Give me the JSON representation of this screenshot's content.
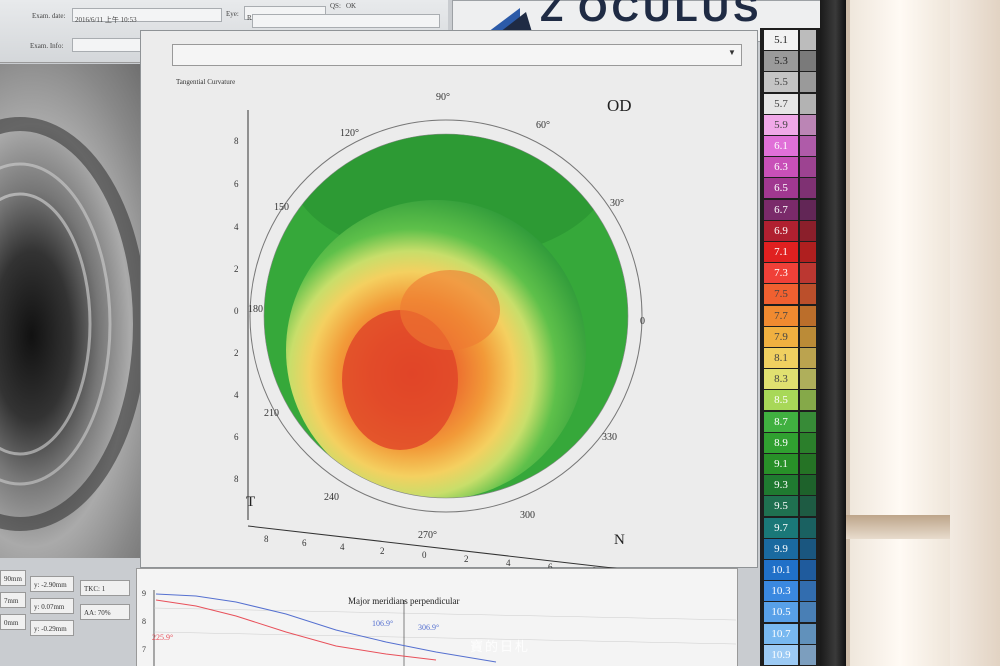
{
  "header": {
    "exam_date_label": "Exam. date:",
    "exam_date_value": "2016/6/11 上午 10:53",
    "eye_label": "Eye:",
    "eye_value": "Right",
    "qs_label": "QS:",
    "qs_value": "OK",
    "exam_info_label": "Exam. Info:"
  },
  "logo": {
    "text": "OCULUS",
    "prefix": "Z"
  },
  "map": {
    "dropdown_value": "Tangential Curvature",
    "eye_side": "OD",
    "temporal_label": "T",
    "nasal_label": "N",
    "angle_labels": [
      "90°",
      "60°",
      "30°",
      "0",
      "330",
      "300",
      "270°",
      "240",
      "210",
      "180",
      "150",
      "120°"
    ],
    "y_ticks": [
      "8",
      "6",
      "4",
      "2",
      "0",
      "2",
      "4",
      "6",
      "8"
    ],
    "x_ticks": [
      "8",
      "6",
      "4",
      "2",
      "0",
      "2",
      "4",
      "6",
      "8"
    ]
  },
  "info": {
    "rows": [
      {
        "a": "90mm",
        "b": "y: -2.90mm",
        "c": "TKC: 1"
      },
      {
        "a": "7mm",
        "b": "y: 0.07mm",
        "c": "AA: 70%"
      },
      {
        "a": "0mm",
        "b": "y: -0.29mm",
        "c": ""
      }
    ]
  },
  "graph": {
    "title": "Major meridians perpendicular",
    "label_left": "225.9°",
    "label_mid1": "106.9°",
    "label_mid2": "306.9°",
    "y_labels": [
      "9",
      "8",
      "7"
    ],
    "colors": {
      "red": "#e8505a",
      "blue": "#5570d0"
    }
  },
  "scale": {
    "values": [
      "5.1",
      "5.3",
      "5.5",
      "5.7",
      "5.9",
      "6.1",
      "6.3",
      "6.5",
      "6.7",
      "6.9",
      "7.1",
      "7.3",
      "7.5",
      "7.7",
      "7.9",
      "8.1",
      "8.3",
      "8.5",
      "8.7",
      "8.9",
      "9.1",
      "9.3",
      "9.5",
      "9.7",
      "9.9",
      "10.1",
      "10.3",
      "10.5",
      "10.7",
      "10.9"
    ],
    "colors": [
      "#f2f2f2",
      "#9a9a9a",
      "#c4c4c4",
      "#e6e6e6",
      "#f0a8e8",
      "#e070d8",
      "#c850b8",
      "#a03890",
      "#7a2a6a",
      "#b02030",
      "#e02020",
      "#f04038",
      "#f06030",
      "#f08a30",
      "#f0b040",
      "#f0d060",
      "#e0e070",
      "#a8d858",
      "#40b040",
      "#30a030",
      "#289028",
      "#1f7a30",
      "#1f7050",
      "#1a7878",
      "#1a6aa0",
      "#2070c8",
      "#3a88e0",
      "#58a0e8",
      "#78b8f0",
      "#9ccaf4"
    ],
    "text_colors": [
      "#222",
      "#222",
      "#444",
      "#444",
      "#444",
      "#fff",
      "#fff",
      "#fff",
      "#fff",
      "#fff",
      "#fff",
      "#fff",
      "#444",
      "#444",
      "#444",
      "#444",
      "#444",
      "#fff",
      "#fff",
      "#fff",
      "#fff",
      "#fff",
      "#fff",
      "#fff",
      "#fff",
      "#fff",
      "#fff",
      "#fff",
      "#fff",
      "#fff"
    ]
  },
  "watermark": "寶的日札"
}
